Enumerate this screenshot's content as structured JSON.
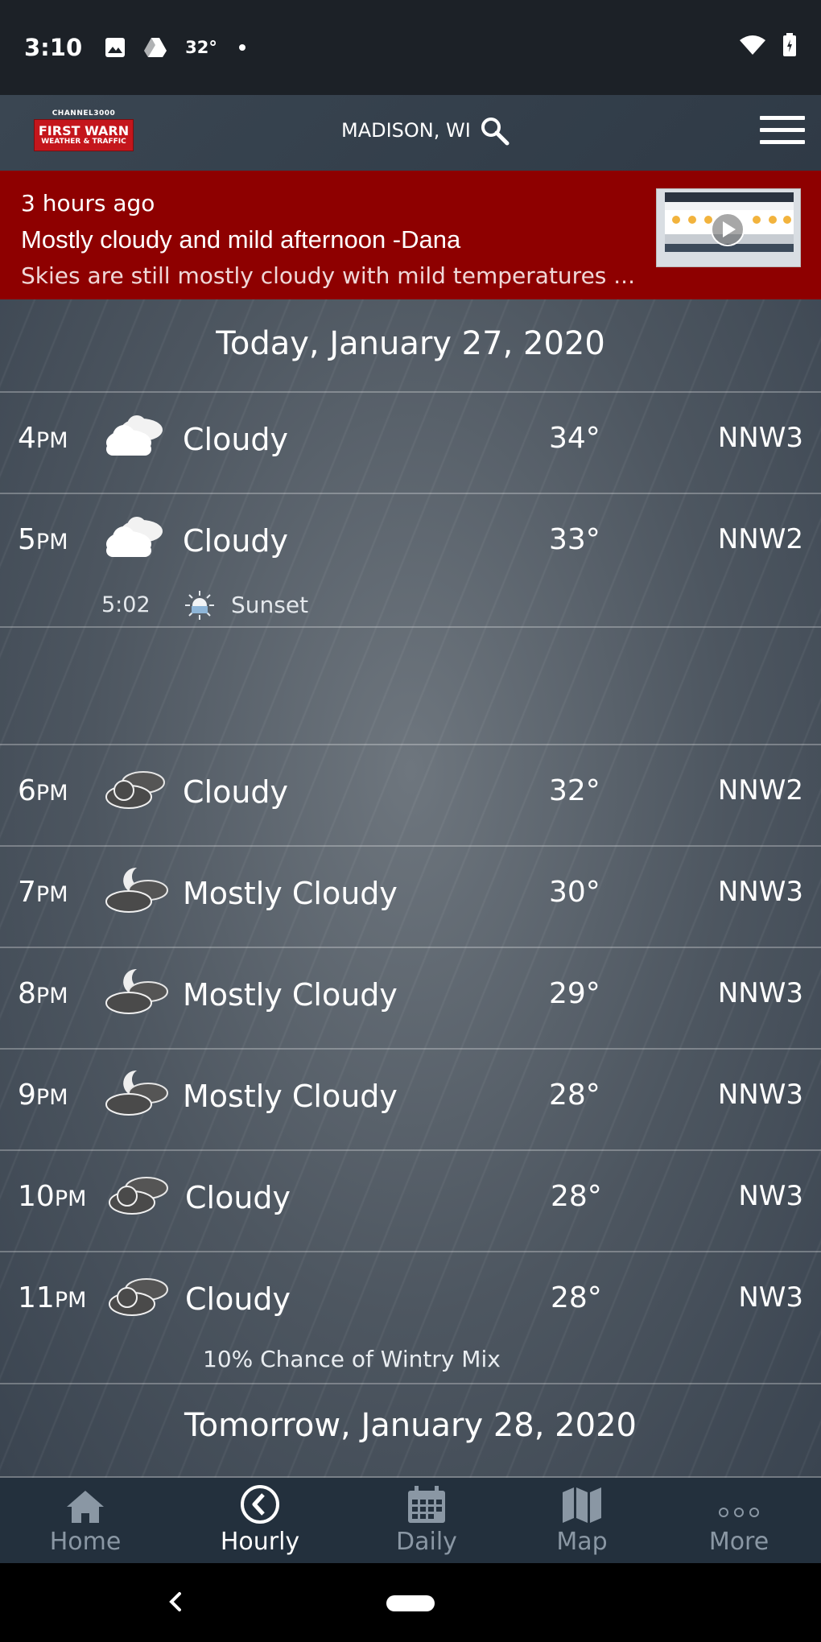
{
  "status_bar": {
    "time": "3:10",
    "temp": "32°"
  },
  "header": {
    "location": "MADISON, WI",
    "logo_channel": "CHANNEL3000",
    "logo_line1": "FIRST WARN",
    "logo_line2": "WEATHER & TRAFFIC"
  },
  "news": {
    "time": "3 hours ago",
    "title": "Mostly cloudy and mild afternoon -Dana",
    "summary": "Skies are still mostly cloudy with mild temperatures ..."
  },
  "today_header": "Today, January 27, 2020",
  "hours": [
    {
      "hour": "4",
      "ampm": "PM",
      "cond": "Cloudy",
      "temp": "34°",
      "wind": "NNW3",
      "icon": "cloudy-icon"
    },
    {
      "hour": "5",
      "ampm": "PM",
      "cond": "Cloudy",
      "temp": "33°",
      "wind": "NNW2",
      "icon": "cloudy-icon"
    },
    {
      "hour": "6",
      "ampm": "PM",
      "cond": "Cloudy",
      "temp": "32°",
      "wind": "NNW2",
      "icon": "cloudy-night-icon"
    },
    {
      "hour": "7",
      "ampm": "PM",
      "cond": "Mostly Cloudy",
      "temp": "30°",
      "wind": "NNW3",
      "icon": "mostly-cloudy-night-icon"
    },
    {
      "hour": "8",
      "ampm": "PM",
      "cond": "Mostly Cloudy",
      "temp": "29°",
      "wind": "NNW3",
      "icon": "mostly-cloudy-night-icon"
    },
    {
      "hour": "9",
      "ampm": "PM",
      "cond": "Mostly Cloudy",
      "temp": "28°",
      "wind": "NNW3",
      "icon": "mostly-cloudy-night-icon"
    },
    {
      "hour": "10",
      "ampm": "PM",
      "cond": "Cloudy",
      "temp": "28°",
      "wind": "NW3",
      "icon": "cloudy-night-icon"
    },
    {
      "hour": "11",
      "ampm": "PM",
      "cond": "Cloudy",
      "temp": "28°",
      "wind": "NW3",
      "icon": "cloudy-night-icon"
    }
  ],
  "sunset": {
    "time": "5:02",
    "label": "Sunset"
  },
  "precip_note": "10% Chance of Wintry Mix",
  "tomorrow_header": "Tomorrow, January 28, 2020",
  "nav": {
    "home": "Home",
    "hourly": "Hourly",
    "daily": "Daily",
    "map": "Map",
    "more": "More",
    "active": "hourly"
  },
  "colors": {
    "alert_red": "#8e0000",
    "nav_bg": "#23303d",
    "nav_inactive": "#8a97a4"
  }
}
